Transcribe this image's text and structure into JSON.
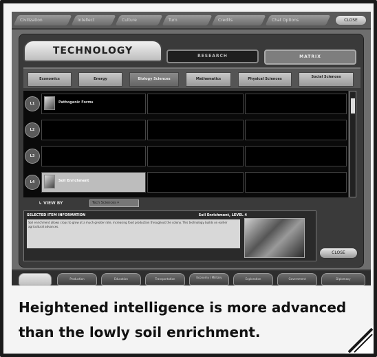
{
  "top_bar": {
    "segments": [
      "Civilization",
      "Intellect",
      "Culture",
      "Turn",
      "Credits",
      "Chat Options"
    ],
    "close_label": "CLOSE"
  },
  "panel": {
    "title": "TECHNOLOGY",
    "tabs": {
      "research": "RESEARCH",
      "matrix": "MATRIX"
    },
    "categories": [
      "Economics",
      "Energy",
      "Biology Sciences",
      "Mathematics",
      "Physical Sciences",
      "Social Sciences"
    ],
    "active_category": "Biology Sciences",
    "levels": [
      "L1",
      "L2",
      "L3",
      "L4"
    ],
    "grid_items": [
      {
        "level": "L1",
        "name": "Pathogenic Forms"
      },
      {
        "level": "L4",
        "name": "Soil Enrichment"
      }
    ],
    "view_by": {
      "label": "VIEW BY",
      "value": "Tech Sciences"
    },
    "info": {
      "heading": "SELECTED ITEM INFORMATION",
      "item": "Soil Enrichment, LEVEL 4",
      "text": "Soil enrichment allows crops to grow at a much greater rate, increasing food production throughout the colony. This technology builds on earlier agricultural advances."
    },
    "close_label": "CLOSE"
  },
  "bottom_tabs": [
    "",
    "Production",
    "Education",
    "Transportation",
    "Economy / Military",
    "Exploration",
    "Government",
    "Diplomacy"
  ],
  "caption": "Heightened intelligence is more advanced than the lowly soil enrichment."
}
